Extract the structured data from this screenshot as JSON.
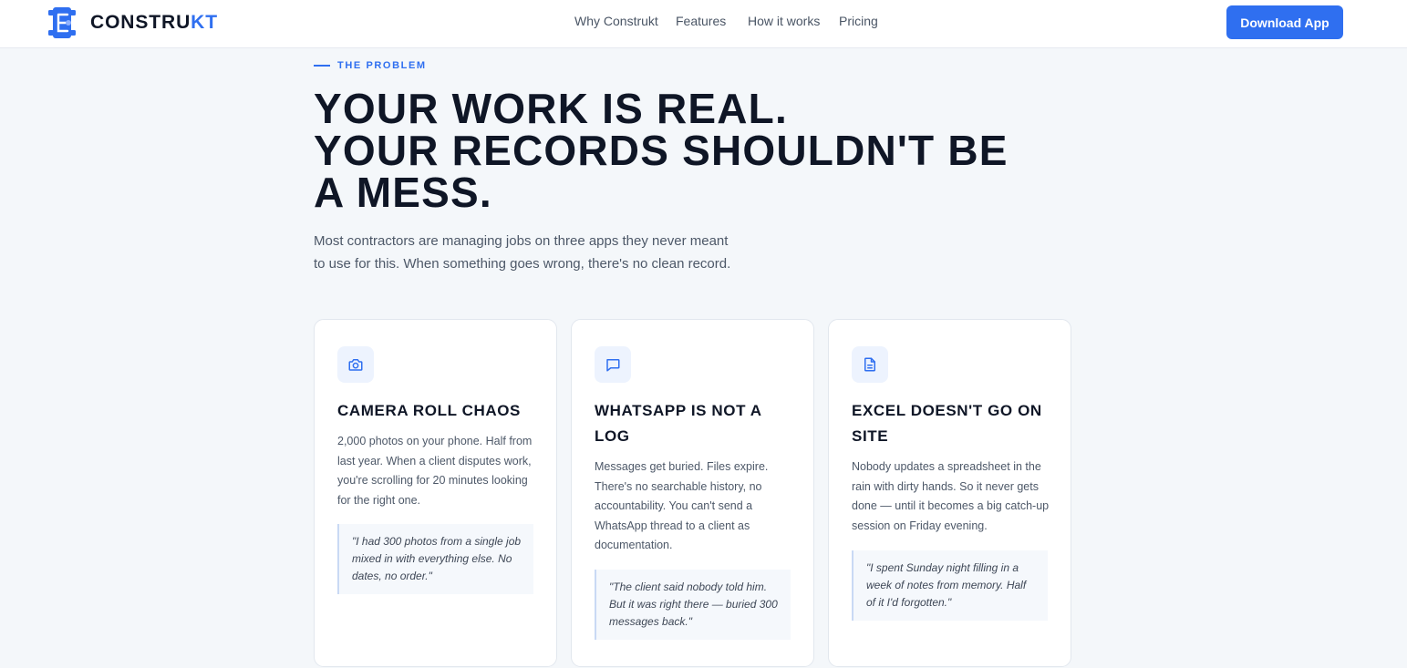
{
  "brand": {
    "name_prefix": "CONSTRU",
    "name_accent": "KT",
    "logo_icon": "construkt-logo-icon",
    "accent_color": "#2f6ff0"
  },
  "nav": {
    "links": [
      "Why Construkt",
      "Features",
      "How it works",
      "Pricing"
    ],
    "cta_label": "Download App"
  },
  "problem": {
    "eyebrow": "THE PROBLEM",
    "headline_lines": [
      "YOUR WORK IS REAL.",
      "YOUR RECORDS SHOULDN'T BE",
      "A MESS."
    ],
    "intro": "Most contractors are managing jobs on three apps they never meant to use for this. When something goes wrong, there's no clean record."
  },
  "cards": [
    {
      "icon": "camera-icon",
      "title": "CAMERA ROLL CHAOS",
      "body": "2,000 photos on your phone. Half from last year. When a client disputes work, you're scrolling for 20 minutes looking for the right one.",
      "quote": "\"I had 300 photos from a single job mixed in with everything else. No dates, no order.\""
    },
    {
      "icon": "message-icon",
      "title": "WHATSAPP IS NOT A LOG",
      "body": "Messages get buried. Files expire. There's no searchable history, no accountability. You can't send a WhatsApp thread to a client as documentation.",
      "quote": "\"The client said nobody told him. But it was right there — buried 300 messages back.\""
    },
    {
      "icon": "document-icon",
      "title": "EXCEL DOESN'T GO ON SITE",
      "body": "Nobody updates a spreadsheet in the rain with dirty hands. So it never gets done — until it becomes a big catch-up session on Friday evening.",
      "quote": "\"I spent Sunday night filling in a week of notes from memory. Half of it I'd forgotten.\""
    }
  ]
}
